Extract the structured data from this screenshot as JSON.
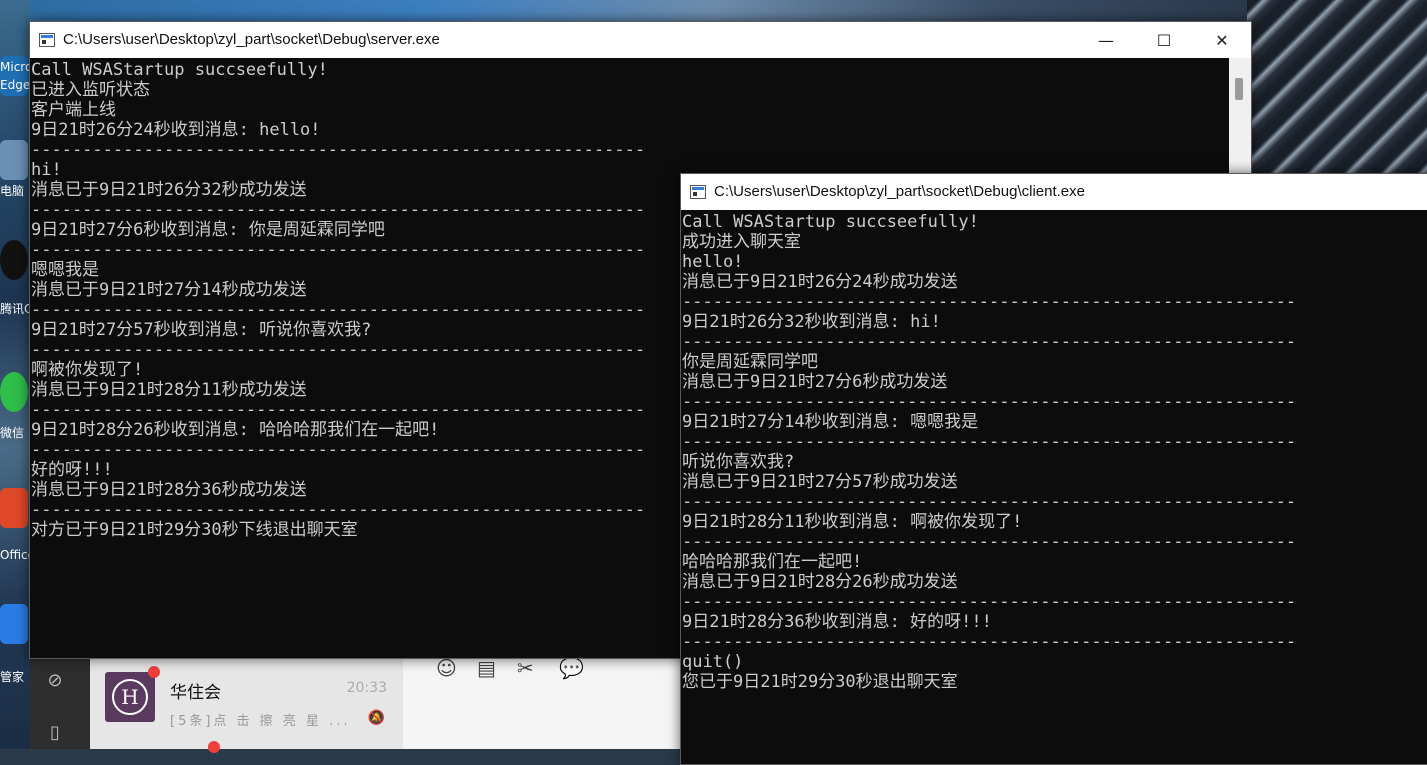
{
  "desktop": {
    "icons": [
      {
        "label": "Micros",
        "sub": "Edge"
      },
      {
        "label": "电脑"
      },
      {
        "label": "腾讯QQ"
      },
      {
        "label": "微信"
      },
      {
        "label": "Office"
      },
      {
        "label": "管家"
      }
    ]
  },
  "chat_app": {
    "contact": {
      "avatar_letter": "H",
      "name": "华住会",
      "time": "20:33",
      "preview": "[5条]点 击 擦 亮 星 ..."
    }
  },
  "server_window": {
    "title": "C:\\Users\\user\\Desktop\\zyl_part\\socket\\Debug\\server.exe",
    "buttons": {
      "minimize": "—",
      "maximize": "☐",
      "close": "✕"
    },
    "lines": [
      "Call WSAStartup succseefully!",
      "已进入监听状态",
      "客户端上线",
      "9日21时26分24秒收到消息: hello!",
      "------------------------------------------------------------",
      "hi!",
      "消息已于9日21时26分32秒成功发送",
      "------------------------------------------------------------",
      "9日21时27分6秒收到消息: 你是周延霖同学吧",
      "------------------------------------------------------------",
      "嗯嗯我是",
      "消息已于9日21时27分14秒成功发送",
      "------------------------------------------------------------",
      "9日21时27分57秒收到消息: 听说你喜欢我?",
      "------------------------------------------------------------",
      "啊被你发现了!",
      "消息已于9日21时28分11秒成功发送",
      "------------------------------------------------------------",
      "9日21时28分26秒收到消息: 哈哈哈那我们在一起吧!",
      "------------------------------------------------------------",
      "好的呀!!!",
      "消息已于9日21时28分36秒成功发送",
      "------------------------------------------------------------",
      "对方已于9日21时29分30秒下线退出聊天室"
    ]
  },
  "client_window": {
    "title": "C:\\Users\\user\\Desktop\\zyl_part\\socket\\Debug\\client.exe",
    "lines": [
      "Call WSAStartup succseefully!",
      "成功进入聊天室",
      "hello!",
      "消息已于9日21时26分24秒成功发送",
      "------------------------------------------------------------",
      "9日21时26分32秒收到消息: hi!",
      "------------------------------------------------------------",
      "你是周延霖同学吧",
      "消息已于9日21时27分6秒成功发送",
      "------------------------------------------------------------",
      "9日21时27分14秒收到消息: 嗯嗯我是",
      "------------------------------------------------------------",
      "听说你喜欢我?",
      "消息已于9日21时27分57秒成功发送",
      "------------------------------------------------------------",
      "9日21时28分11秒收到消息: 啊被你发现了!",
      "------------------------------------------------------------",
      "哈哈哈那我们在一起吧!",
      "消息已于9日21时28分26秒成功发送",
      "------------------------------------------------------------",
      "9日21时28分36秒收到消息: 好的呀!!!",
      "------------------------------------------------------------",
      "quit()",
      "您已于9日21时29分30秒退出聊天室"
    ]
  },
  "colors": {
    "console_bg": "#0c0c0c",
    "console_fg": "#cccccc",
    "titlebar_bg": "#ffffff"
  }
}
